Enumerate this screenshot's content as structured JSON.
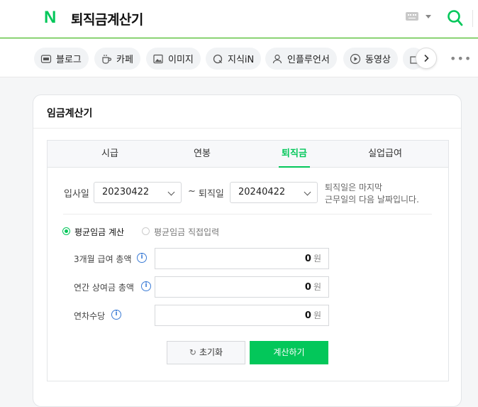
{
  "header": {
    "logo": "N",
    "query": "퇴직금계산기"
  },
  "search_tabs": [
    {
      "label": "블로그",
      "icon": "blog-icon"
    },
    {
      "label": "카페",
      "icon": "cafe-icon"
    },
    {
      "label": "이미지",
      "icon": "image-icon"
    },
    {
      "label": "지식iN",
      "icon": "knowledge-icon"
    },
    {
      "label": "인플루언서",
      "icon": "person-icon"
    },
    {
      "label": "동영상",
      "icon": "play-icon"
    }
  ],
  "more_label": "•••",
  "card": {
    "title": "임금계산기"
  },
  "calc_tabs": [
    {
      "label": "시급"
    },
    {
      "label": "연봉"
    },
    {
      "label": "퇴직금",
      "active": true
    },
    {
      "label": "실업급여"
    }
  ],
  "dates": {
    "start_label": "입사일",
    "start_value": "20230422",
    "tilde": "~",
    "end_label": "퇴직일",
    "end_value": "20240422",
    "note_line1": "퇴직일은 마지막",
    "note_line2": "근무일의 다음 날짜입니다."
  },
  "mode": {
    "option_avg": "평균임금 계산",
    "option_direct": "평균임금 직접입력",
    "selected": "평균임금 계산"
  },
  "fields": [
    {
      "label": "3개월 급여 총액",
      "value": "0",
      "unit": "원"
    },
    {
      "label": "연간 상여금 총액",
      "value": "0",
      "unit": "원"
    },
    {
      "label": "연차수당",
      "value": "0",
      "unit": "원"
    }
  ],
  "info_glyph": "i",
  "buttons": {
    "reset": "초기화",
    "reset_icon": "↻",
    "calculate": "계산하기"
  },
  "colors": {
    "accent": "#03c75a",
    "info": "#3a7bd5"
  }
}
